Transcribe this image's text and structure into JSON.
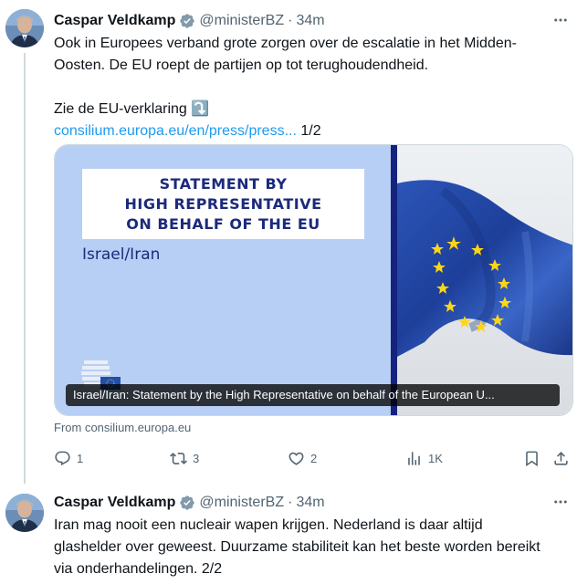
{
  "tweets": [
    {
      "author_name": "Caspar Veldkamp",
      "handle": "@ministerBZ",
      "separator": "·",
      "time": "34m",
      "lines": [
        "Ook in Europees verband grote zorgen over de escalatie in het Midden-",
        "Oosten. De EU roept de partijen op tot terughoudendheid."
      ],
      "cta_text": "Zie de EU-verklaring",
      "cta_emoji": "⤵️",
      "link_text": "consilium.europa.eu/en/press/press...",
      "counter": "1/2",
      "card": {
        "statement_lines": [
          "STATEMENT BY",
          "HIGH REPRESENTATIVE",
          "ON BEHALF OF THE EU"
        ],
        "subject": "Israel/Iran",
        "caption": "Israel/Iran: Statement by the High Representative on behalf of the European U..."
      },
      "from_text": "From consilium.europa.eu",
      "actions": {
        "replies": "1",
        "reposts": "3",
        "likes": "2",
        "views": "1K"
      }
    },
    {
      "author_name": "Caspar Veldkamp",
      "handle": "@ministerBZ",
      "separator": "·",
      "time": "34m",
      "lines": [
        "Iran mag nooit een nucleair wapen krijgen. Nederland is daar altijd",
        "glashelder over geweest. Duurzame stabiliteit kan het beste worden bereikt",
        "via onderhandelingen. 2/2"
      ]
    }
  ],
  "colors": {
    "accent": "#1d9bf0",
    "verified": "#829aab",
    "secondary_text": "#536471",
    "card_blue": "#b8cff5",
    "eu_navy": "#1c2a7c"
  }
}
